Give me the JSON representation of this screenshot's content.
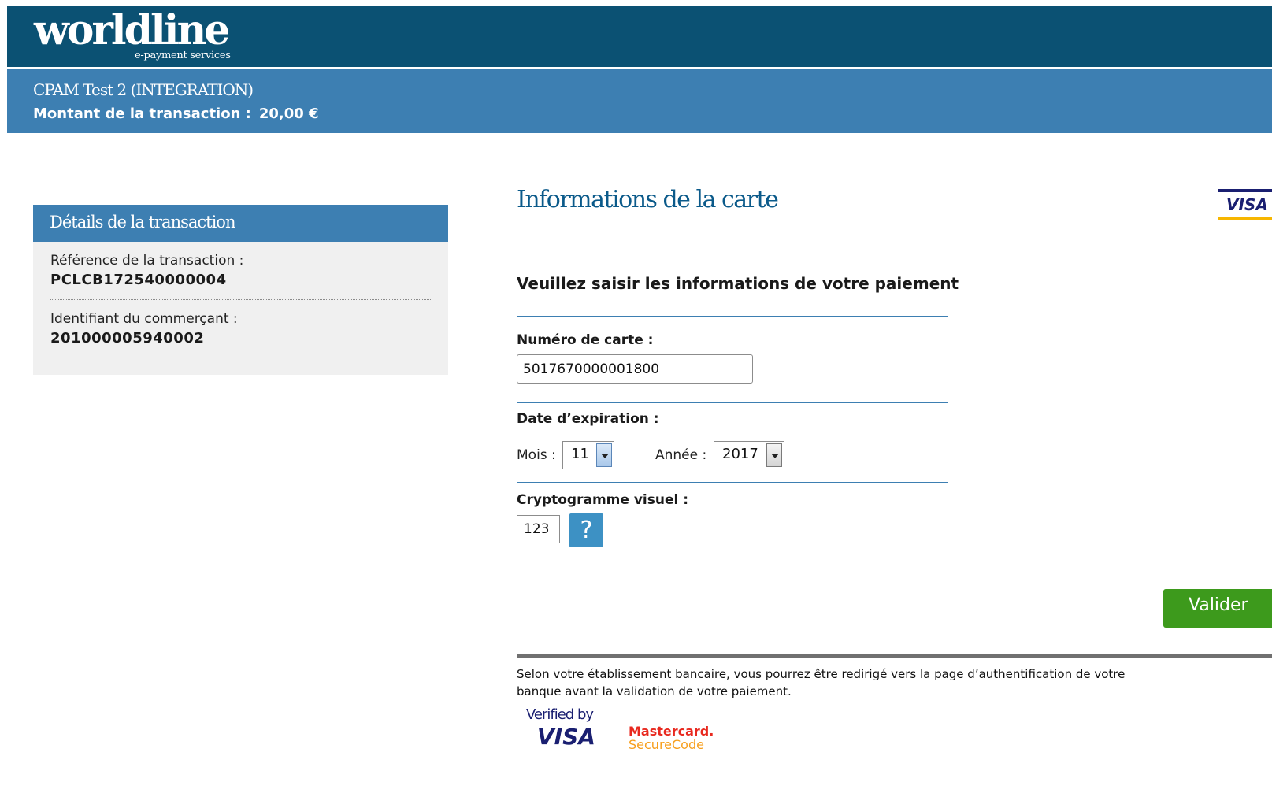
{
  "header": {
    "logo_text": "worldline",
    "logo_subtitle": "e-payment services"
  },
  "merchant_bar": {
    "merchant_name": "CPAM Test 2 (INTEGRATION)",
    "amount_label": "Montant de la transaction :",
    "amount_value": "20,00 €"
  },
  "details": {
    "title": "Détails de la transaction",
    "items": [
      {
        "label": "Référence de la transaction :",
        "value": "PCLCB172540000004"
      },
      {
        "label": "Identifiant du commerçant :",
        "value": "201000005940002"
      }
    ]
  },
  "card_form": {
    "section_title": "Informations de la carte",
    "card_brand": "VISA",
    "prompt": "Veuillez saisir les informations de votre paiement",
    "card_number_label": "Numéro de carte :",
    "card_number_value": "5017670000001800",
    "expiry_label": "Date d’expiration :",
    "month_label": "Mois :",
    "month_value": "11",
    "year_label": "Année :",
    "year_value": "2017",
    "cvv_label": "Cryptogramme visuel :",
    "cvv_value": "123",
    "help_symbol": "?",
    "submit_label": "Valider"
  },
  "footer": {
    "notice": "Selon votre établissement bancaire, vous pourrez être redirigé vers la page d’authentification de votre banque avant la validation de votre paiement.",
    "verified_by_top": "Verified by",
    "verified_by_brand": "VISA",
    "mastercard_line1": "Mastercard.",
    "mastercard_line2": "SecureCode"
  }
}
